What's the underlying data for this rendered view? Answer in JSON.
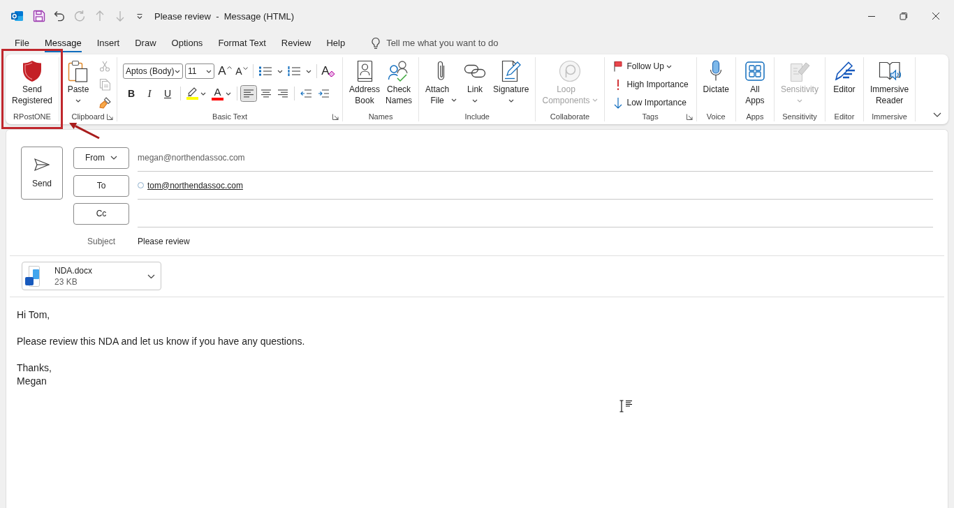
{
  "window": {
    "title": "Please review  -  Message (HTML)"
  },
  "quick_access": [
    {
      "kind": "save",
      "disabled": false
    },
    {
      "kind": "undo",
      "disabled": false
    },
    {
      "kind": "redo",
      "disabled": true
    },
    {
      "kind": "up",
      "disabled": true
    },
    {
      "kind": "down",
      "disabled": true
    }
  ],
  "tabs": [
    {
      "label": "File",
      "selected": false
    },
    {
      "label": "Message",
      "selected": true
    },
    {
      "label": "Insert",
      "selected": false
    },
    {
      "label": "Draw",
      "selected": false
    },
    {
      "label": "Options",
      "selected": false
    },
    {
      "label": "Format Text",
      "selected": false
    },
    {
      "label": "Review",
      "selected": false
    },
    {
      "label": "Help",
      "selected": false
    }
  ],
  "search": {
    "placeholder": "Tell me what you want to do"
  },
  "ribbon": {
    "groups": [
      {
        "kind": "buttons",
        "label": "RPostONE",
        "launcher": false,
        "highlighted": true,
        "commands": [
          {
            "label": "Send Registered",
            "disabled": false
          }
        ]
      },
      {
        "kind": "clipboard",
        "label": "Clipboard",
        "launcher": true,
        "highlighted": false,
        "commands": [
          {
            "label": "Paste",
            "disabled": false,
            "dropdown": true
          }
        ],
        "tools": [
          {
            "kind": "cut",
            "disabled": true
          },
          {
            "kind": "copy",
            "disabled": true
          },
          {
            "kind": "painter",
            "disabled": false
          }
        ]
      },
      {
        "kind": "text",
        "label": "Basic Text",
        "launcher": true,
        "highlighted": false,
        "font": "Aptos (Body)",
        "size": "11",
        "size_buttons": [
          {
            "kind": "grow",
            "label": "A"
          },
          {
            "kind": "shrink",
            "label": "A"
          }
        ],
        "lists": [
          {
            "kind": "bullets"
          },
          {
            "kind": "numbering"
          }
        ],
        "clear": {
          "label": "A"
        },
        "styles": [
          {
            "kind": "bold",
            "label": "B"
          },
          {
            "kind": "italic",
            "label": "I"
          },
          {
            "kind": "underline",
            "label": "U"
          }
        ],
        "colors": [
          {
            "kind": "highlight",
            "color": "#ffff00"
          },
          {
            "kind": "font",
            "label": "A",
            "color": "#ff0000"
          }
        ],
        "alignment": [
          {
            "kind": "left",
            "selected": true
          },
          {
            "kind": "center",
            "selected": false
          },
          {
            "kind": "right",
            "selected": false
          }
        ],
        "indent": [
          {
            "kind": "decrease"
          },
          {
            "kind": "increase"
          }
        ]
      },
      {
        "kind": "buttons",
        "label": "Names",
        "launcher": false,
        "highlighted": false,
        "commands": [
          {
            "label": "Address Book",
            "disabled": false
          },
          {
            "label": "Check Names",
            "disabled": false
          }
        ]
      },
      {
        "kind": "buttons",
        "label": "Include",
        "launcher": false,
        "highlighted": false,
        "commands": [
          {
            "label": "Attach File",
            "disabled": false,
            "dropdown": true
          },
          {
            "label": "Link",
            "disabled": false,
            "dropdown": true
          },
          {
            "label": "Signature",
            "disabled": false,
            "dropdown": true
          }
        ]
      },
      {
        "kind": "buttons",
        "label": "Collaborate",
        "launcher": false,
        "highlighted": false,
        "commands": [
          {
            "label": "Loop Components",
            "disabled": true,
            "dropdown": true
          }
        ]
      },
      {
        "kind": "list",
        "label": "Tags",
        "launcher": true,
        "highlighted": false,
        "items": [
          {
            "kind": "flag",
            "label": "Follow Up",
            "dropdown": true
          },
          {
            "kind": "high",
            "label": "High Importance"
          },
          {
            "kind": "low",
            "label": "Low Importance"
          }
        ]
      },
      {
        "kind": "buttons",
        "label": "Voice",
        "launcher": false,
        "highlighted": false,
        "commands": [
          {
            "label": "Dictate",
            "disabled": false
          }
        ]
      },
      {
        "kind": "buttons",
        "label": "Apps",
        "launcher": false,
        "highlighted": false,
        "commands": [
          {
            "label": "All Apps",
            "disabled": false
          }
        ]
      },
      {
        "kind": "buttons",
        "label": "Sensitivity",
        "launcher": false,
        "highlighted": false,
        "commands": [
          {
            "label": "Sensitivity",
            "disabled": true,
            "dropdown": true
          }
        ]
      },
      {
        "kind": "buttons",
        "label": "Editor",
        "launcher": false,
        "highlighted": false,
        "commands": [
          {
            "label": "Editor",
            "disabled": false
          }
        ]
      },
      {
        "kind": "buttons",
        "label": "Immersive",
        "launcher": false,
        "highlighted": false,
        "commands": [
          {
            "label": "Immersive Reader",
            "disabled": false
          }
        ]
      }
    ]
  },
  "compose": {
    "send": "Send",
    "from": {
      "label": "From",
      "value": "megan@northendassoc.com"
    },
    "to": {
      "label": "To",
      "recipients": [
        "tom@northendassoc.com"
      ]
    },
    "cc": {
      "label": "Cc"
    },
    "subject": {
      "label": "Subject",
      "value": "Please review"
    },
    "attachments": [
      {
        "name": "NDA.docx",
        "size": "23 KB"
      }
    ],
    "body": [
      [
        "Hi Tom,"
      ],
      [
        "Please review this NDA and let us know if you have any questions."
      ],
      [
        "Thanks,",
        "Megan"
      ]
    ]
  }
}
